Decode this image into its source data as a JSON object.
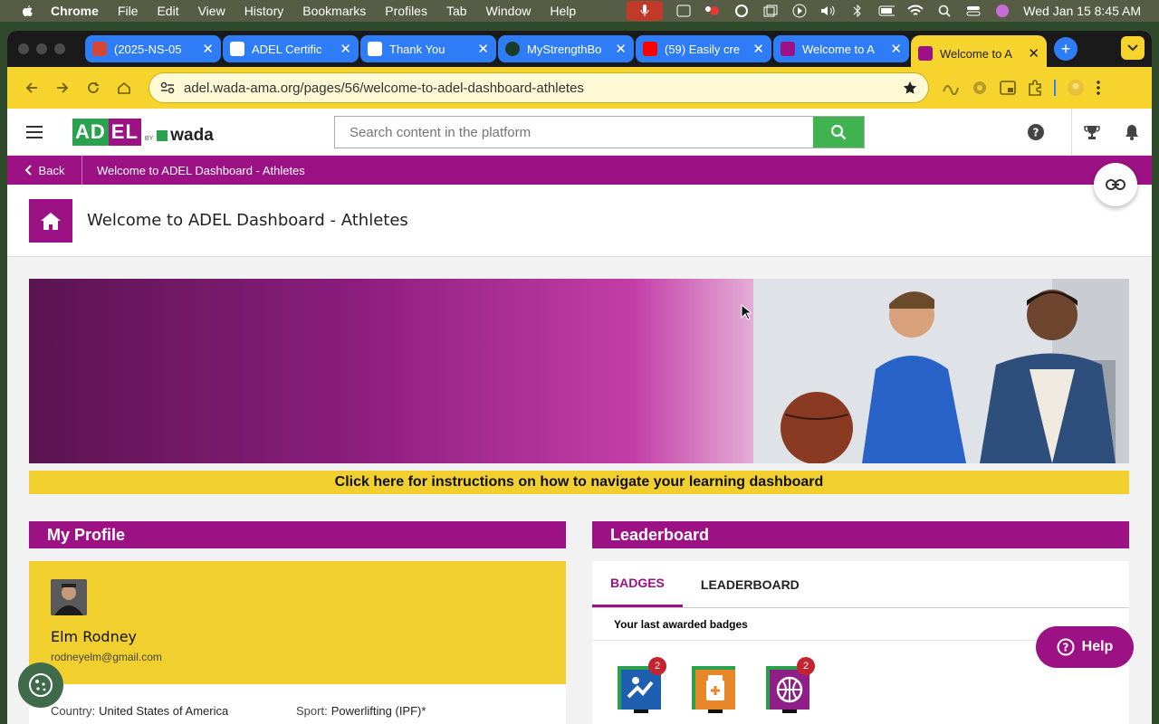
{
  "menubar": {
    "app": "Chrome",
    "items": [
      "File",
      "Edit",
      "View",
      "History",
      "Bookmarks",
      "Profiles",
      "Tab",
      "Window",
      "Help"
    ],
    "clock": "Wed Jan 15  8:45 AM"
  },
  "tabs": [
    {
      "title": "(2025-NS-05",
      "favicon_color": "#d44638"
    },
    {
      "title": "ADEL Certific",
      "favicon_color": "#ffffff"
    },
    {
      "title": "Thank You",
      "favicon_color": "#ffffff"
    },
    {
      "title": "MyStrengthBo",
      "favicon_color": "#1d3b2a"
    },
    {
      "title": "(59) Easily cre",
      "favicon_color": "#ff0000"
    },
    {
      "title": "Welcome to A",
      "favicon_color": "#9c1285"
    },
    {
      "title": "Welcome to A",
      "favicon_color": "#9c1285",
      "active": true
    }
  ],
  "address_bar": {
    "url": "adel.wada-ama.org/pages/56/welcome-to-adel-dashboard-athletes"
  },
  "header": {
    "logo": {
      "left": "AD",
      "right": "EL",
      "by": "BY",
      "brand": "wada"
    },
    "search_placeholder": "Search content in the platform"
  },
  "breadcrumb": {
    "back": "Back",
    "current": "Welcome to ADEL Dashboard - Athletes"
  },
  "page_title": "Welcome to ADEL Dashboard - Athletes",
  "instructions_link": "Click here for instructions on how to navigate your learning dashboard",
  "profile": {
    "heading": "My Profile",
    "name": "Elm Rodney",
    "email": "rodneyelm@gmail.com",
    "country_label": "Country:",
    "country": "United States of America",
    "sport_label": "Sport:",
    "sport": "Powerlifting (IPF)*"
  },
  "leaderboard": {
    "heading": "Leaderboard",
    "tabs": [
      "BADGES",
      "LEADERBOARD"
    ],
    "subtitle": "Your last awarded badges",
    "badges": [
      {
        "icon": "athlete-badge-icon",
        "color": "#1f5fb0",
        "count": "2"
      },
      {
        "icon": "medication-badge-icon",
        "color": "#e8862a",
        "count": ""
      },
      {
        "icon": "globe-badge-icon",
        "color": "#8f1f86",
        "count": "2"
      }
    ]
  },
  "help_button": "Help",
  "colors": {
    "brand_magenta": "#9c1285",
    "brand_yellow": "#f0cf2e",
    "brand_green": "#3fb34f"
  }
}
